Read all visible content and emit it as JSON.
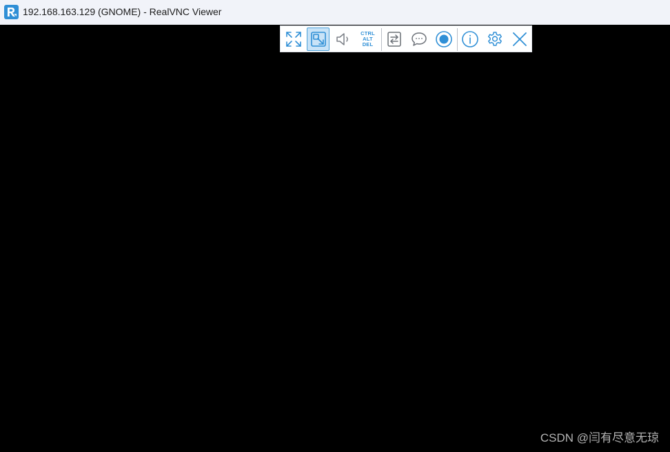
{
  "window": {
    "title": "192.168.163.129 (GNOME) - RealVNC Viewer",
    "app_icon": "realvnc-logo-icon"
  },
  "toolbar": {
    "accent_color": "#2f8fd6",
    "buttons": [
      {
        "name": "fullscreen-button",
        "icon": "expand-arrows-icon"
      },
      {
        "name": "scaling-button",
        "icon": "scale-to-window-icon",
        "active": true
      },
      {
        "name": "audio-button",
        "icon": "speaker-icon"
      },
      {
        "name": "ctrl-alt-del-button",
        "icon": "ctrl-alt-del-icon",
        "lines": [
          "CTRL",
          "ALT",
          "DEL"
        ]
      },
      {
        "name": "file-transfer-button",
        "icon": "transfer-arrows-icon"
      },
      {
        "name": "chat-button",
        "icon": "chat-bubble-icon"
      },
      {
        "name": "record-button",
        "icon": "record-icon"
      },
      {
        "name": "info-button",
        "icon": "info-icon"
      },
      {
        "name": "settings-button",
        "icon": "gear-icon"
      },
      {
        "name": "close-button",
        "icon": "close-icon"
      }
    ]
  },
  "watermark": {
    "text": "CSDN @闫有尽意无琼"
  }
}
